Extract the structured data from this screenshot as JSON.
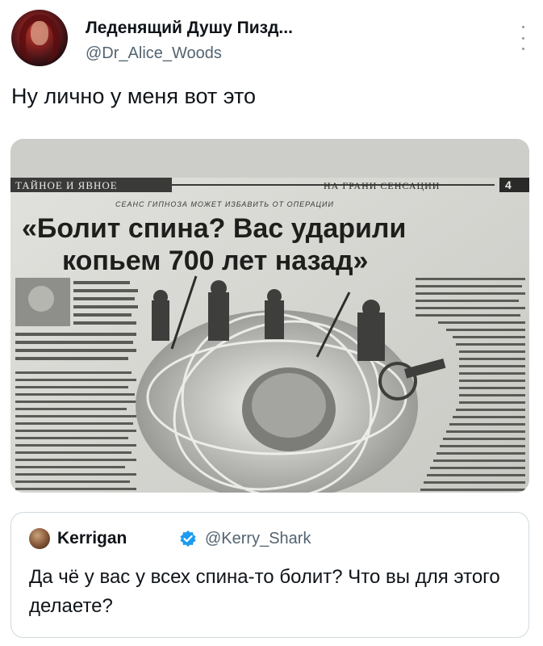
{
  "author": {
    "display_name": "Леденящий Душу Пизд...",
    "handle": "@Dr_Alice_Woods"
  },
  "tweet": {
    "text": "Ну лично у меня вот это"
  },
  "media": {
    "section_left": "ТАЙНОЕ И ЯВНОЕ",
    "section_right": "НА ГРАНИ СЕНСАЦИИ",
    "page_number": "4",
    "kicker": "СЕАНС ГИПНОЗА МОЖЕТ ИЗБАВИТЬ ОТ ОПЕРАЦИИ",
    "headline_line1": "«Болит спина? Вас ударили",
    "headline_line2": "копьем 700 лет назад»"
  },
  "quote": {
    "display_name": "Kerrigan",
    "handle": "@Kerry_Shark",
    "text": "Да чё у вас у всех спина-то болит? Что вы для этого делаете?"
  },
  "colors": {
    "text_primary": "#0f1419",
    "text_secondary": "#536471",
    "border": "#cfd9de",
    "verified": "#1d9bf0"
  }
}
